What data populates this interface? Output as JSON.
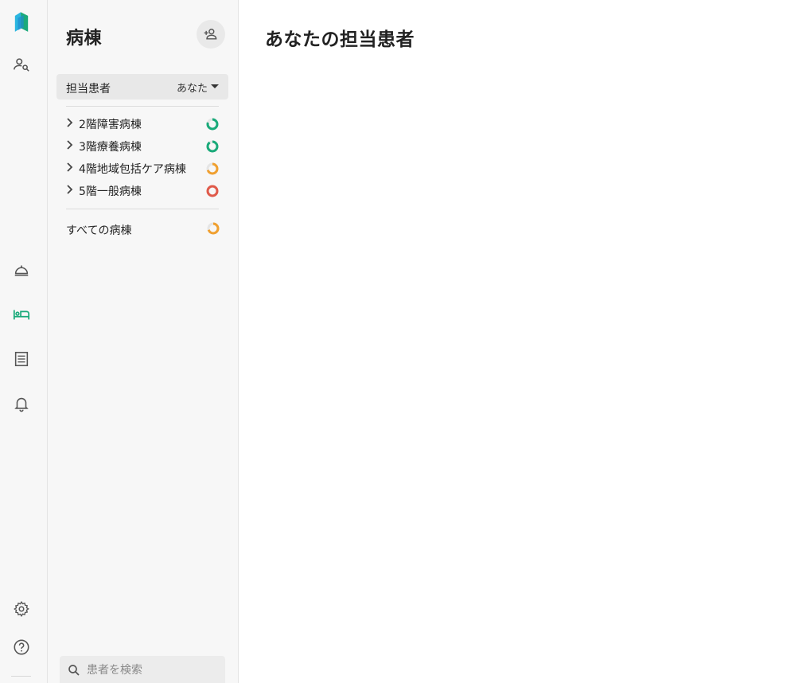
{
  "app": {
    "brand_color": "#18a0c8",
    "accent_color": "#1aaa7a"
  },
  "rail": {
    "items": [
      {
        "icon": "logo-icon"
      },
      {
        "icon": "patient-search-icon"
      },
      {
        "icon": "call-bell-icon"
      },
      {
        "icon": "bed-icon",
        "active": true
      },
      {
        "icon": "list-icon"
      },
      {
        "icon": "bell-icon"
      },
      {
        "icon": "gear-icon"
      },
      {
        "icon": "help-icon"
      }
    ]
  },
  "sidebar": {
    "title": "病棟",
    "filter": {
      "label": "担当患者",
      "value": "あなた"
    },
    "wards": [
      {
        "label": "2階障害病棟",
        "status_color": "#1aaa7a",
        "fill": 0.8
      },
      {
        "label": "3階療養病棟",
        "status_color": "#1aaa7a",
        "fill": 0.9
      },
      {
        "label": "4階地域包括ケア病棟",
        "status_color": "#f0a030",
        "fill": 0.7
      },
      {
        "label": "5階一般病棟",
        "status_color": "#e05a4a",
        "fill": 1.0
      }
    ],
    "all_wards": {
      "label": "すべての病棟",
      "status_color": "#f0a030",
      "fill": 0.7
    },
    "search": {
      "placeholder": "患者を検索"
    }
  },
  "main": {
    "title": "あなたの担当患者"
  }
}
